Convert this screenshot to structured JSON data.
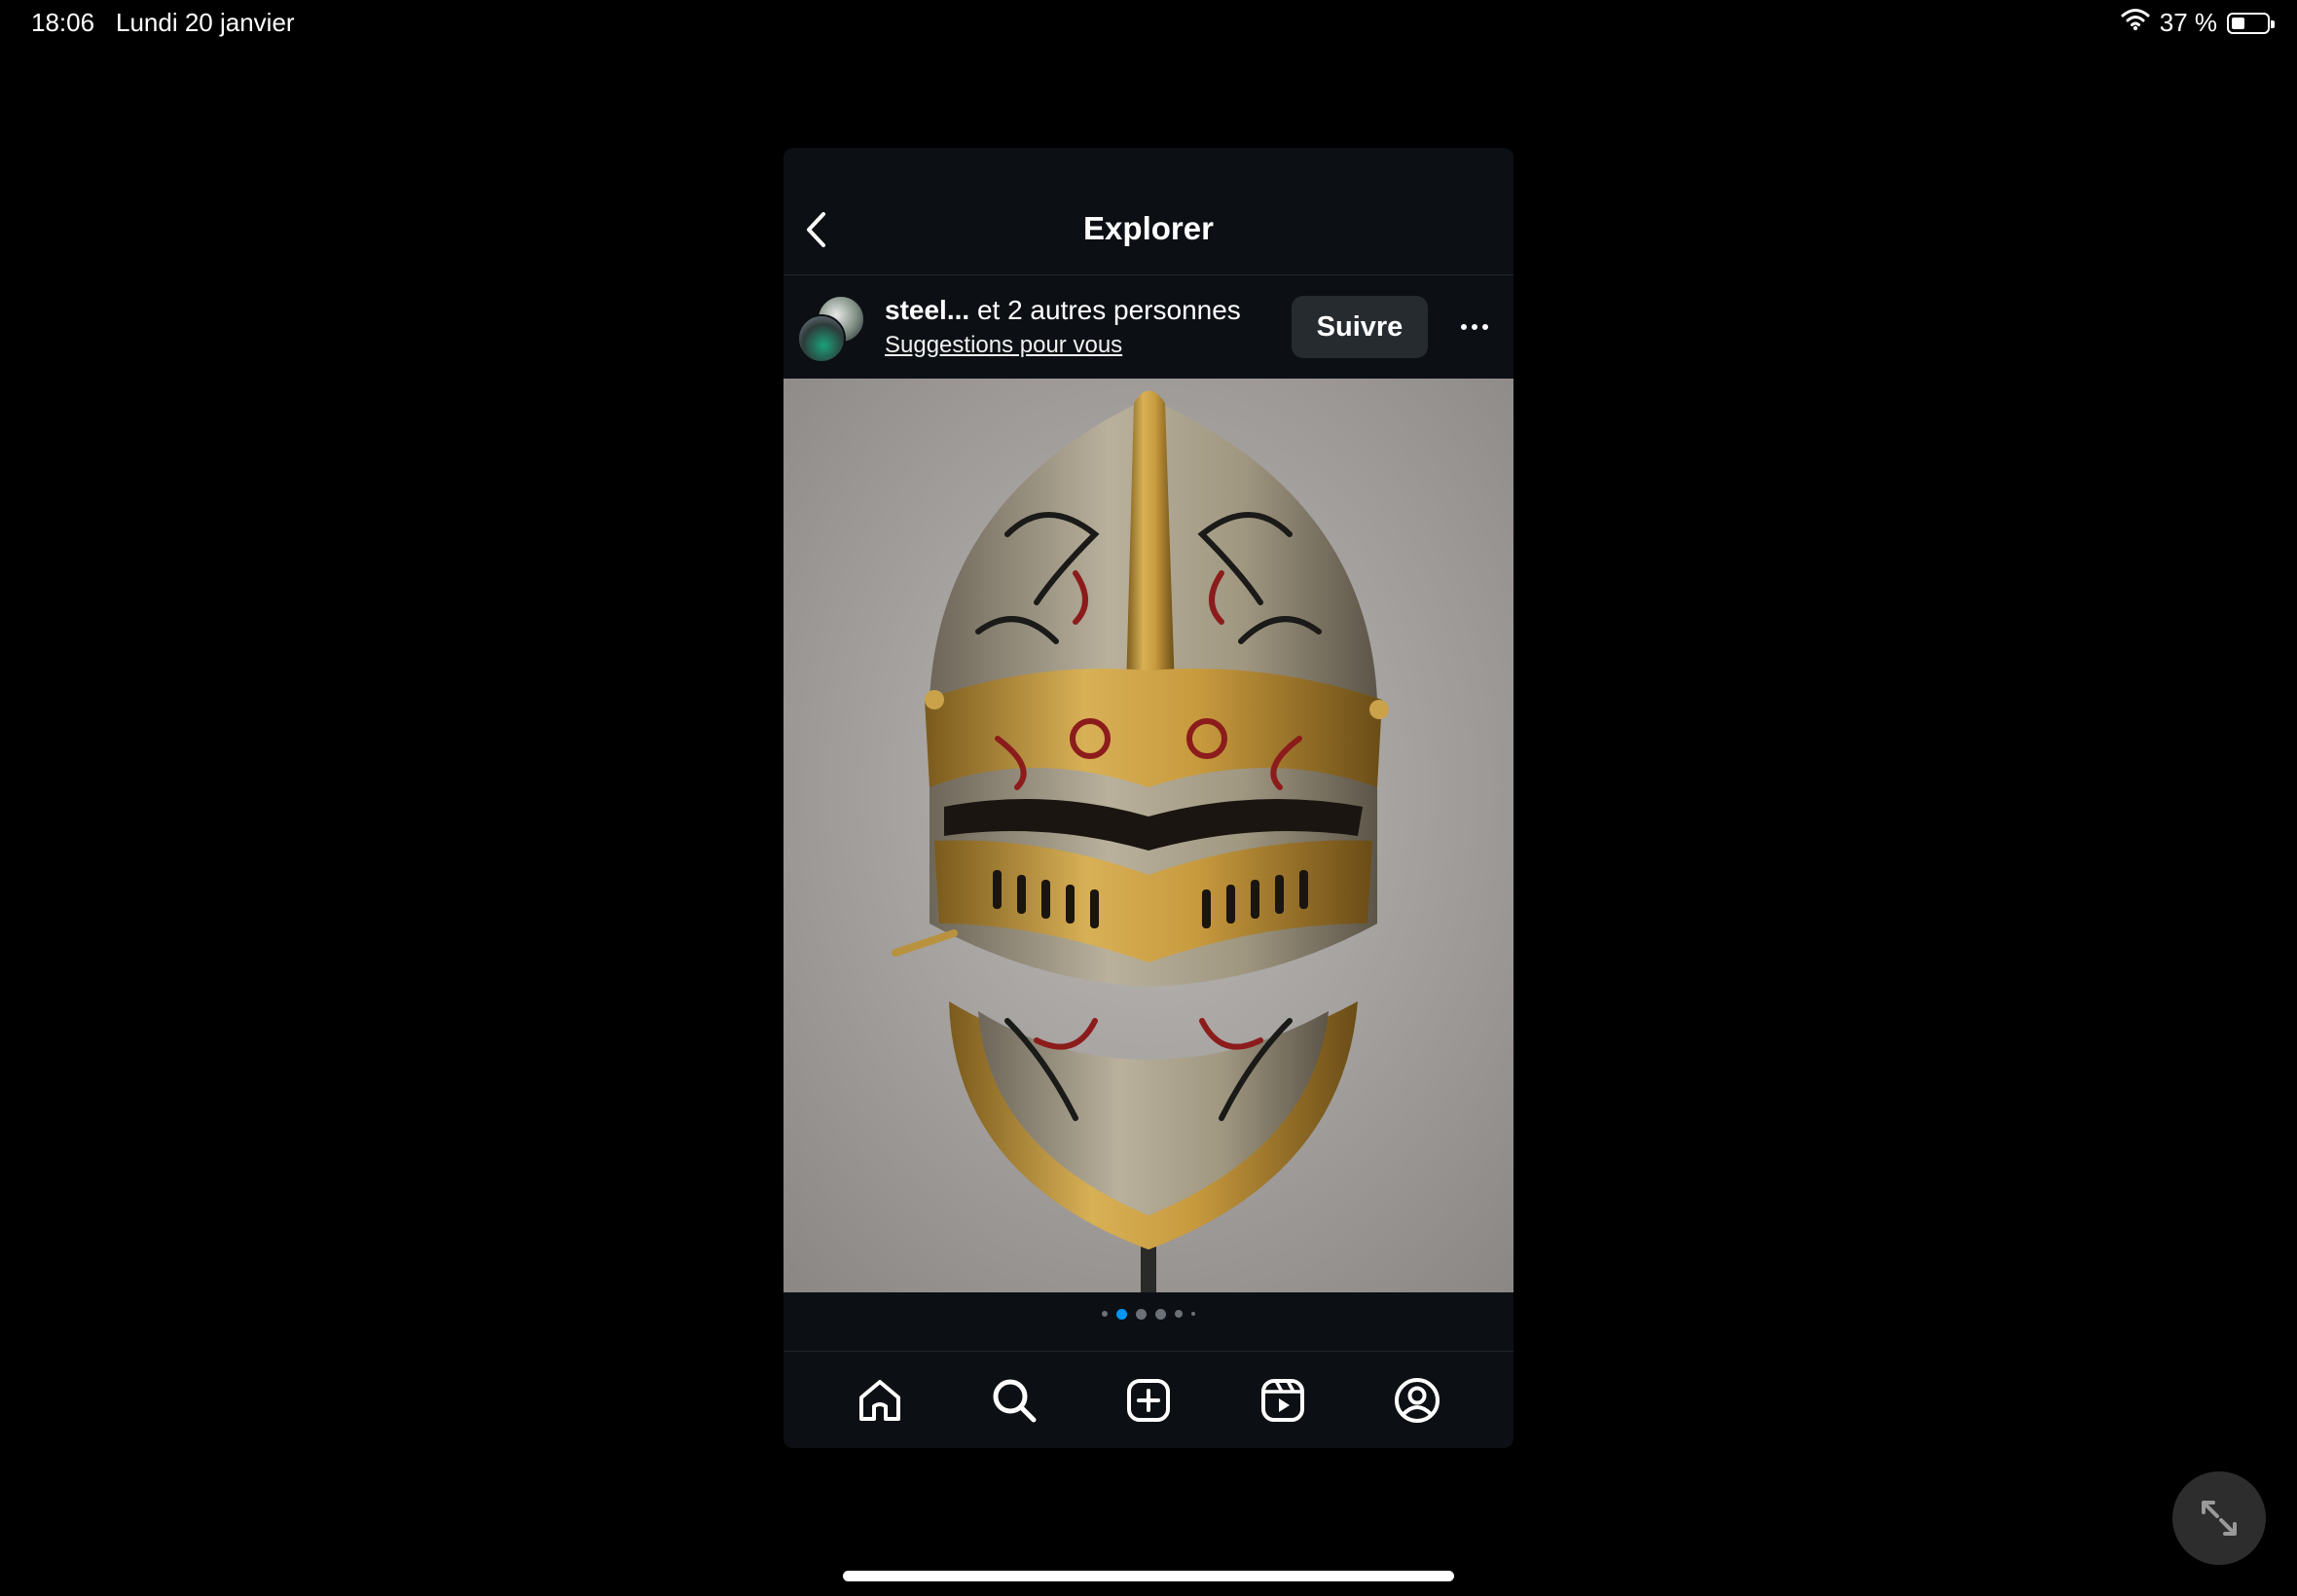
{
  "status_bar": {
    "time": "18:06",
    "date": "Lundi 20 janvier",
    "battery_text": "37 %",
    "battery_level": 0.37,
    "icons": [
      "wifi-icon",
      "battery-icon"
    ]
  },
  "header": {
    "title": "Explorer",
    "back_icon": "chevron-left-icon"
  },
  "post": {
    "user_name": "steel...",
    "user_suffix": " et 2 autres personnes",
    "subtitle": "Suggestions pour vous",
    "follow_label": "Suivre",
    "more_icon": "ellipsis-icon",
    "image_subject": "ornate-helmet",
    "carousel": {
      "count": 6,
      "active_index": 1
    }
  },
  "tab_bar": {
    "items": [
      "home-icon",
      "search-icon",
      "create-icon",
      "reels-icon",
      "profile-icon"
    ]
  },
  "colors": {
    "background": "#000000",
    "panel": "#0c1014",
    "accent": "#0095f6",
    "button": "#262b30"
  }
}
